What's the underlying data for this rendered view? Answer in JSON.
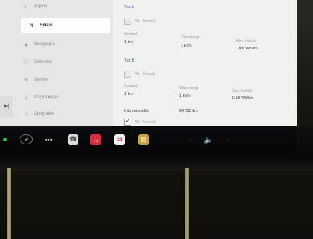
{
  "sidebar": {
    "items": [
      {
        "label": "Skjerm",
        "icon": "display-icon",
        "active": false
      },
      {
        "label": "Reiser",
        "icon": "trips-icon",
        "active": true
      },
      {
        "label": "Navigasjon",
        "icon": "navigation-icon",
        "active": false
      },
      {
        "label": "Sikkerhet",
        "icon": "safety-icon",
        "active": false
      },
      {
        "label": "Service",
        "icon": "service-icon",
        "active": false
      },
      {
        "label": "Programvare",
        "icon": "software-icon",
        "active": false
      },
      {
        "label": "Oppgrader",
        "icon": "upgrade-icon",
        "active": false
      }
    ],
    "collapse_glyph": "▶︎|"
  },
  "trip_a": {
    "title": "Tur A",
    "show_label": "Vis i Turbord",
    "distance_label": "Avstand",
    "distance_value": "1 km",
    "energy_label": "Total energi",
    "energy_value": "1 kWh",
    "avg_label": "Gjsn. forbruk",
    "avg_value": "1168 Wh/km"
  },
  "trip_b": {
    "title": "Tur B",
    "show_label": "Vis i Turbord",
    "distance_label": "Avstand",
    "distance_value": "1 km",
    "energy_label": "Total energi",
    "energy_value": "1 kWh",
    "avg_label": "Gjsn. forbruk",
    "avg_value": "1168 Wh/km"
  },
  "odometer": {
    "label": "Kilometerteller",
    "value": "84 793 km",
    "show_label": "Vis i Turbord"
  },
  "taskbar": {
    "more_glyph": "•••",
    "calendar_glyph": "31",
    "prev_glyph": "‹",
    "volume_glyph": "🔈",
    "next_glyph": "›"
  }
}
